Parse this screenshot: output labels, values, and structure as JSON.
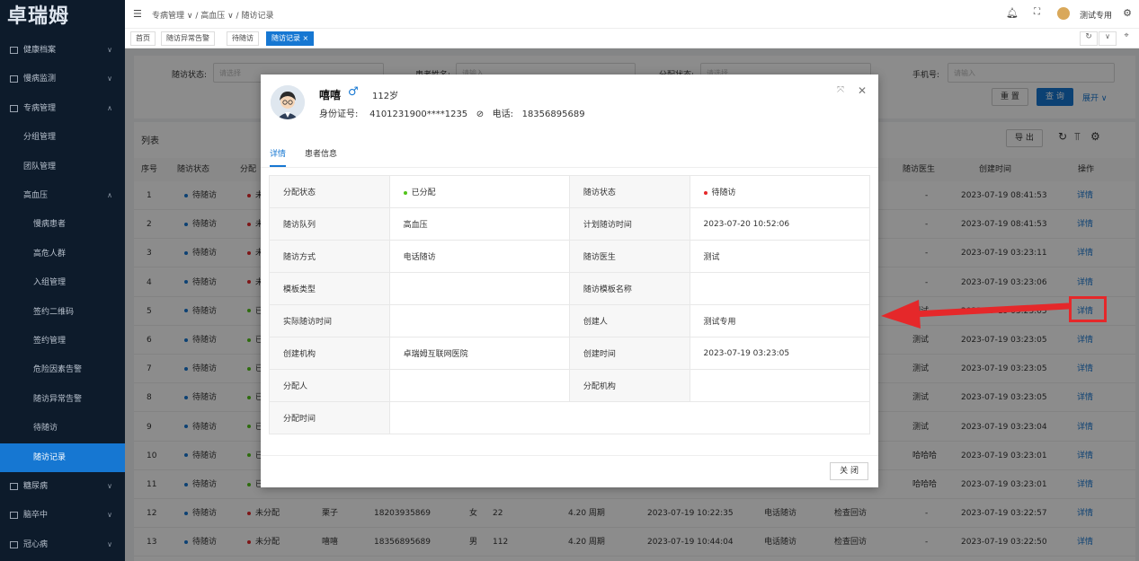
{
  "app": {
    "logo": "卓瑞姆"
  },
  "sidebar": {
    "items": [
      {
        "label": "健康档案",
        "level": 0
      },
      {
        "label": "慢病监测",
        "level": 0
      },
      {
        "label": "专病管理",
        "level": 0
      },
      {
        "label": "分组管理",
        "level": 1
      },
      {
        "label": "团队管理",
        "level": 1
      },
      {
        "label": "高血压",
        "level": 1
      },
      {
        "label": "慢病患者",
        "level": 2
      },
      {
        "label": "高危人群",
        "level": 2
      },
      {
        "label": "入组管理",
        "level": 2
      },
      {
        "label": "签约二维码",
        "level": 2
      },
      {
        "label": "签约管理",
        "level": 2
      },
      {
        "label": "危险因素告警",
        "level": 2
      },
      {
        "label": "随访异常告警",
        "level": 2
      },
      {
        "label": "待随访",
        "level": 2
      },
      {
        "label": "随访记录",
        "level": 2,
        "active": true
      },
      {
        "label": "糖尿病",
        "level": 0
      },
      {
        "label": "脑卒中",
        "level": 0
      },
      {
        "label": "冠心病",
        "level": 0
      }
    ]
  },
  "header": {
    "breadcrumb": [
      "专病管理",
      "高血压",
      "随访记录"
    ],
    "user": "测试专用"
  },
  "tabs": [
    "首页",
    "随访异常告警",
    "待随访",
    "随访记录"
  ],
  "filters": {
    "visit_status_label": "随访状态:",
    "visit_status_placeholder": "请选择",
    "patient_name_label": "患者姓名:",
    "patient_name_placeholder": "请输入",
    "assign_status_label": "分配状态:",
    "assign_status_placeholder": "请选择",
    "phone_label": "手机号:",
    "phone_placeholder": "请输入",
    "reset": "重 置",
    "search": "查 询",
    "expand": "展开"
  },
  "list": {
    "title": "列表",
    "export": "导 出",
    "columns": [
      "序号",
      "随访状态",
      "分配",
      "随访医生",
      "创建时间",
      "操作"
    ],
    "rows": [
      {
        "no": "1",
        "status": "待随访",
        "assign": "未",
        "doctor": "-",
        "created": "2023-07-19 08:41:53",
        "op": "详情"
      },
      {
        "no": "2",
        "status": "待随访",
        "assign": "未",
        "doctor": "-",
        "created": "2023-07-19 08:41:53",
        "op": "详情"
      },
      {
        "no": "3",
        "status": "待随访",
        "assign": "未",
        "doctor": "-",
        "created": "2023-07-19 03:23:11",
        "op": "详情"
      },
      {
        "no": "4",
        "status": "待随访",
        "assign": "未",
        "doctor": "-",
        "created": "2023-07-19 03:23:06",
        "op": "详情"
      },
      {
        "no": "5",
        "status": "待随访",
        "assign": "已",
        "doctor": "测试",
        "created": "2023-07-19 03:23:05",
        "op": "详情"
      },
      {
        "no": "6",
        "status": "待随访",
        "assign": "已",
        "doctor": "测试",
        "created": "2023-07-19 03:23:05",
        "op": "详情"
      },
      {
        "no": "7",
        "status": "待随访",
        "assign": "已",
        "doctor": "测试",
        "created": "2023-07-19 03:23:05",
        "op": "详情"
      },
      {
        "no": "8",
        "status": "待随访",
        "assign": "已",
        "doctor": "测试",
        "created": "2023-07-19 03:23:05",
        "op": "详情"
      },
      {
        "no": "9",
        "status": "待随访",
        "assign": "已",
        "doctor": "测试",
        "created": "2023-07-19 03:23:04",
        "op": "详情"
      },
      {
        "no": "10",
        "status": "待随访",
        "assign": "已",
        "doctor": "哈哈哈",
        "created": "2023-07-19 03:23:01",
        "op": "详情"
      },
      {
        "no": "11",
        "status": "待随访",
        "assign": "已",
        "doctor": "哈哈哈",
        "created": "2023-07-19 03:23:01",
        "op": "详情"
      }
    ],
    "full_rows": [
      {
        "no": "12",
        "status": "待随访",
        "assign": "未分配",
        "name": "栗子",
        "phone": "18203935869",
        "sex": "女",
        "age": "22",
        "plan": "4.20 周期",
        "time": "2023-07-19 10:22:35",
        "method": "电话随访",
        "type": "检查回访",
        "doctor": "-",
        "created": "2023-07-19 03:22:57",
        "op": "详情"
      },
      {
        "no": "13",
        "status": "待随访",
        "assign": "未分配",
        "name": "嘻嘻",
        "phone": "18356895689",
        "sex": "男",
        "age": "112",
        "plan": "4.20 周期",
        "time": "2023-07-19 10:44:04",
        "method": "电话随访",
        "type": "检查回访",
        "doctor": "-",
        "created": "2023-07-19 03:22:50",
        "op": "详情"
      }
    ]
  },
  "modal": {
    "name": "嘻嘻",
    "age": "112岁",
    "id_label": "身份证号:",
    "id_value": "4101231900****1235",
    "phone_label": "电话:",
    "phone_value": "18356895689",
    "tab_detail": "详情",
    "tab_patient": "患者信息",
    "fields": [
      [
        "分配状态",
        "已分配",
        "随访状态",
        "待随访"
      ],
      [
        "随访队列",
        "高血压",
        "计划随访时间",
        "2023-07-20 10:52:06"
      ],
      [
        "随访方式",
        "电话随访",
        "随访医生",
        "测试"
      ],
      [
        "模板类型",
        "",
        "随访模板名称",
        ""
      ],
      [
        "实际随访时间",
        "",
        "创建人",
        "测试专用"
      ],
      [
        "创建机构",
        "卓瑞姆互联网医院",
        "创建时间",
        "2023-07-19 03:23:05"
      ],
      [
        "分配人",
        "",
        "分配机构",
        ""
      ],
      [
        "分配时间",
        "",
        "",
        ""
      ]
    ],
    "close": "关 闭"
  },
  "colors": {
    "primary": "#1677d2",
    "sidebar": "#0d1b2b",
    "annotation": "#e5282a",
    "assigned": "#52c41a",
    "pending": "#e5282a"
  }
}
